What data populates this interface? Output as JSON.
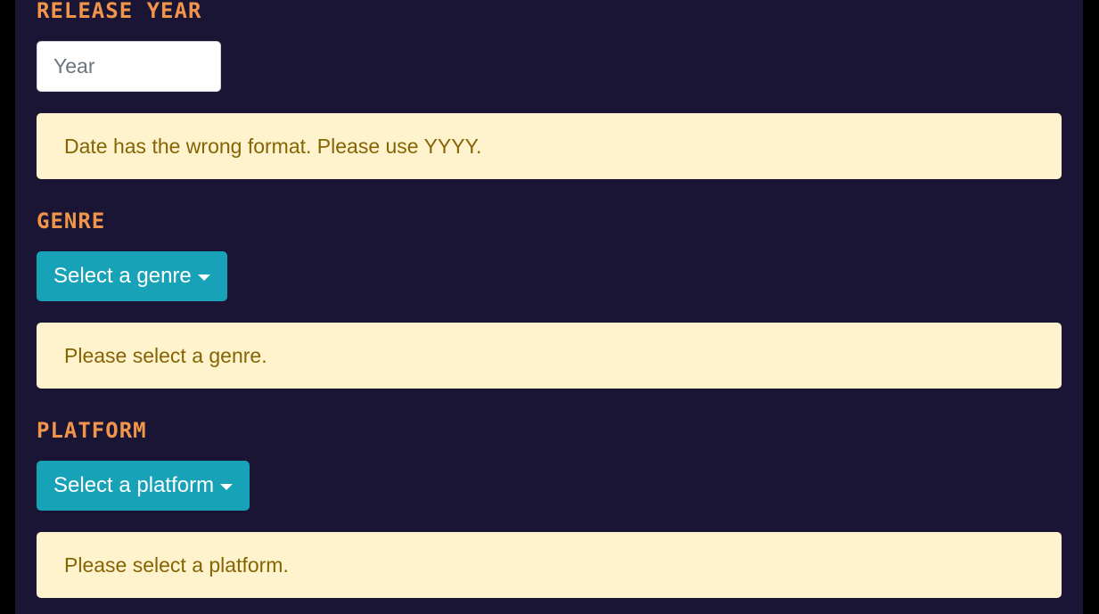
{
  "release_year": {
    "label": "Release Year",
    "input_value": "",
    "placeholder": "Year",
    "error": "Date has the wrong format. Please use YYYY."
  },
  "genre": {
    "label": "Genre",
    "dropdown_label": "Select a genre",
    "error": "Please select a genre."
  },
  "platform": {
    "label": "Platform",
    "dropdown_label": "Select a platform",
    "error": "Please select a platform."
  },
  "colors": {
    "background": "#1a1535",
    "label": "#f0954a",
    "button": "#17a2b8",
    "alert_bg": "#fff3cd",
    "alert_text": "#856404"
  }
}
